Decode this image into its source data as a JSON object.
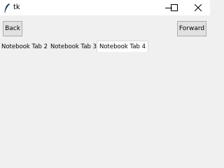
{
  "window": {
    "title": "tk",
    "icon": "feather-icon",
    "controls": [
      "minimize-icon",
      "maximize-icon",
      "close-icon"
    ]
  },
  "toolbar": {
    "back_label": "Back",
    "forward_label": "Forward"
  },
  "notebook": {
    "tabs": [
      {
        "label": "Notebook Tab 2",
        "selected": false
      },
      {
        "label": "Notebook Tab 3",
        "selected": false
      },
      {
        "label": "Notebook Tab 4",
        "selected": true
      }
    ]
  },
  "colors": {
    "background": "#f0f0f0",
    "titlebar": "#ffffff",
    "button": "#e1e1e1",
    "button_border": "#adadad"
  }
}
